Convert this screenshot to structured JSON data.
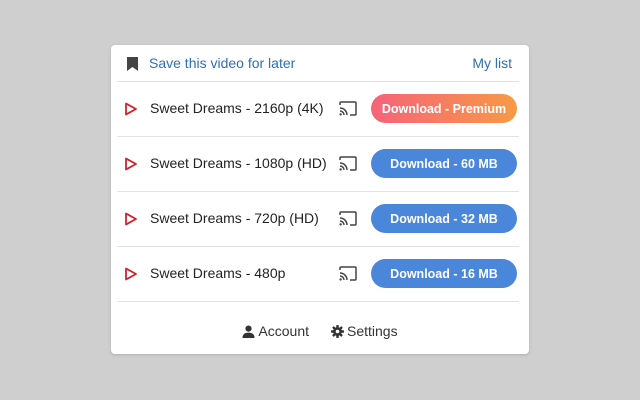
{
  "header": {
    "bookmark_icon": "bookmark-icon",
    "save_label": "Save this video for later",
    "mylist_label": "My list"
  },
  "rows": [
    {
      "title": "Sweet Dreams - 2160p (4K)",
      "button": "Download - Premium",
      "style": "premium"
    },
    {
      "title": "Sweet Dreams - 1080p (HD)",
      "button": "Download - 60 MB",
      "style": "blue"
    },
    {
      "title": "Sweet Dreams - 720p (HD)",
      "button": "Download - 32 MB",
      "style": "blue"
    },
    {
      "title": "Sweet Dreams - 480p",
      "button": "Download - 16 MB",
      "style": "blue"
    }
  ],
  "footer": {
    "account_label": "Account",
    "settings_label": "Settings"
  },
  "colors": {
    "link": "#2f6fb6",
    "play": "#d2232a",
    "button_blue": "#4a86d9",
    "premium_start": "#f5637a",
    "premium_end": "#f79a45"
  }
}
